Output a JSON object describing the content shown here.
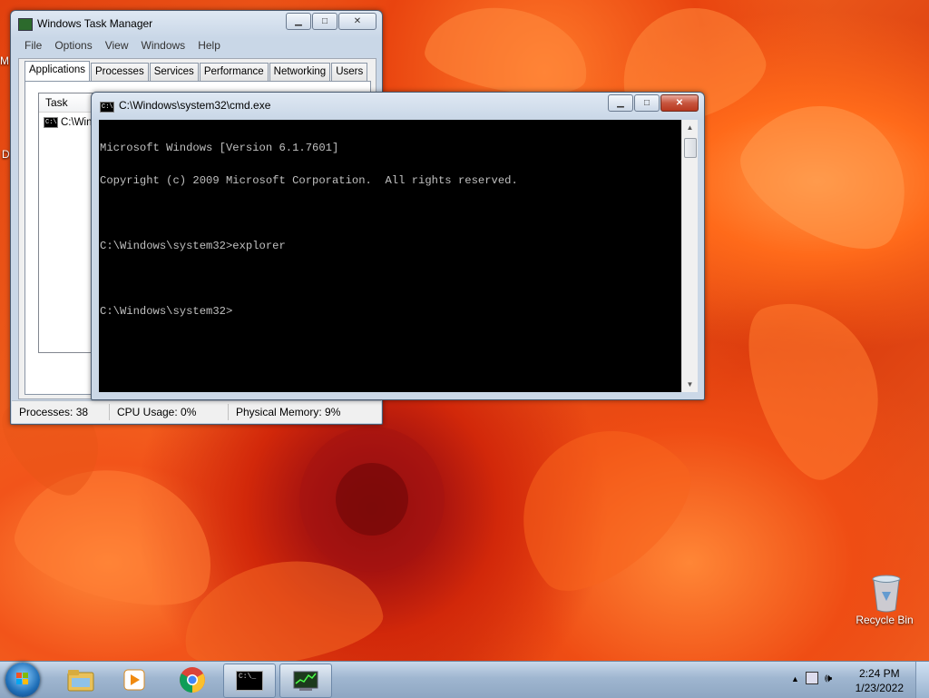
{
  "desktop": {
    "recycle_bin_label": "Recycle Bin",
    "edge_letters": [
      "M",
      "D"
    ]
  },
  "task_manager": {
    "title": "Windows Task Manager",
    "menu": [
      "File",
      "Options",
      "View",
      "Windows",
      "Help"
    ],
    "tabs": [
      "Applications",
      "Processes",
      "Services",
      "Performance",
      "Networking",
      "Users"
    ],
    "active_tab": "Applications",
    "list_header": "Task",
    "rows": [
      "C:\\Windows\\system32\\cmd.exe"
    ],
    "status": {
      "processes": "Processes: 38",
      "cpu": "CPU Usage: 0%",
      "memory": "Physical Memory: 9%"
    }
  },
  "cmd": {
    "title": "C:\\Windows\\system32\\cmd.exe",
    "lines": [
      "Microsoft Windows [Version 6.1.7601]",
      "Copyright (c) 2009 Microsoft Corporation.  All rights reserved.",
      "",
      "C:\\Windows\\system32>explorer",
      "",
      "C:\\Windows\\system32>"
    ]
  },
  "taskbar": {
    "clock_time": "2:24 PM",
    "clock_date": "1/23/2022",
    "pinned": [
      "windows-explorer",
      "media-player",
      "chrome",
      "cmd",
      "task-manager"
    ]
  },
  "colors": {
    "console_bg": "#000000",
    "console_fg": "#c0c0c0",
    "taskbar": "#9fb6d0",
    "wallpaper_accent": "#e2400e"
  }
}
